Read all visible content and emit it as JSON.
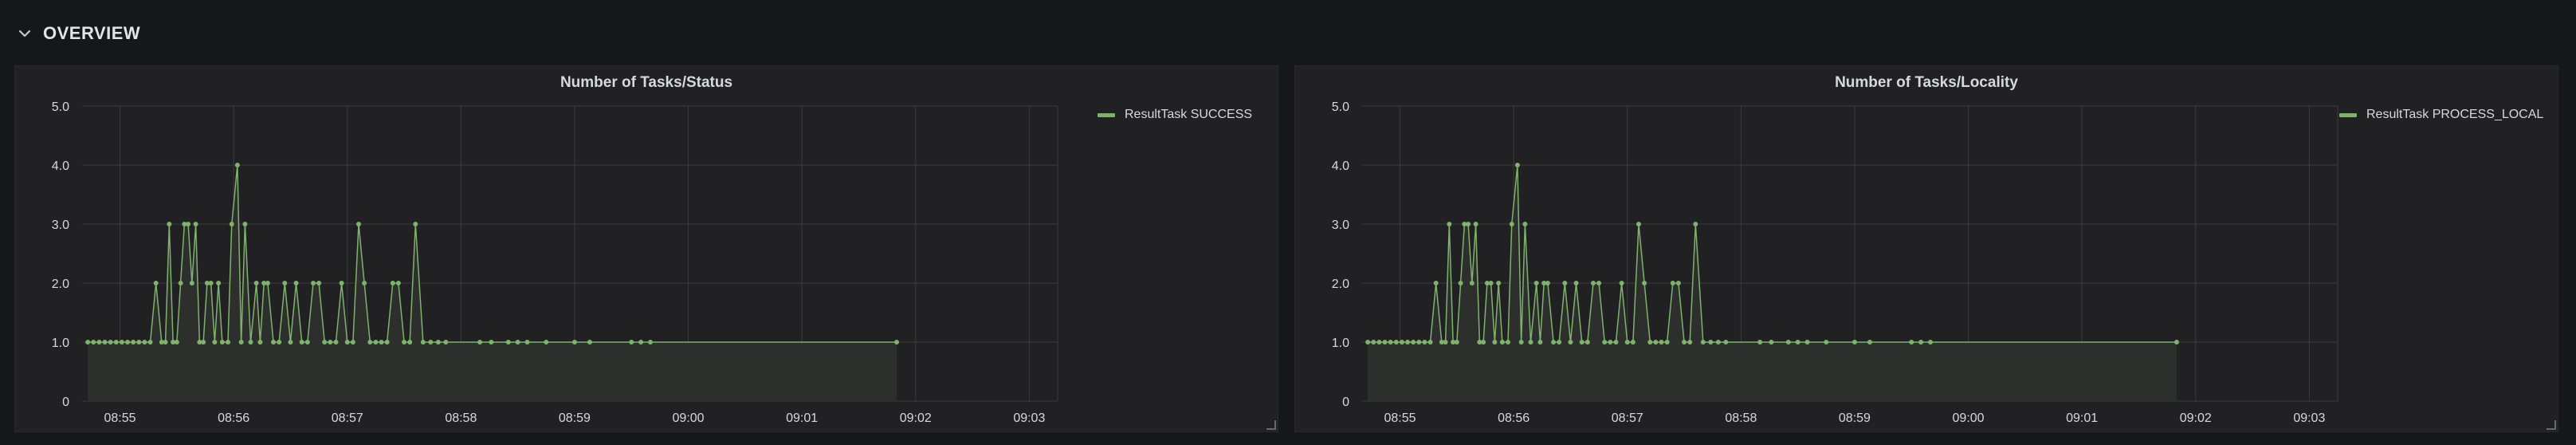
{
  "header": {
    "title": "OVERVIEW",
    "collapse_icon": "chevron-down-icon"
  },
  "colors": {
    "series": "#7eb26d",
    "fill": "#2d2f2c",
    "grid": "#3a3b3e"
  },
  "panels": [
    {
      "title": "Number of Tasks/Status",
      "legend": [
        "ResultTask SUCCESS"
      ]
    },
    {
      "title": "Number of Tasks/Locality",
      "legend": [
        "ResultTask PROCESS_LOCAL"
      ]
    }
  ],
  "chart_data": [
    {
      "type": "line",
      "title": "Number of Tasks/Status",
      "xlabel": "",
      "ylabel": "",
      "ylim": [
        0,
        5
      ],
      "yticks": [
        "0",
        "1.0",
        "2.0",
        "3.0",
        "4.0",
        "5.0"
      ],
      "xlim": [
        "08:54:40",
        "09:03:15"
      ],
      "xticks": [
        "08:55",
        "08:56",
        "08:57",
        "08:58",
        "08:59",
        "09:00",
        "09:01",
        "09:02",
        "09:03"
      ],
      "grid": true,
      "legend_position": "top-right",
      "series": [
        {
          "name": "ResultTask SUCCESS",
          "color": "#7eb26d",
          "x": [
            "08:54:43",
            "08:54:46",
            "08:54:49",
            "08:54:52",
            "08:54:55",
            "08:54:58",
            "08:55:01",
            "08:55:04",
            "08:55:07",
            "08:55:10",
            "08:55:13",
            "08:55:16",
            "08:55:19",
            "08:55:22",
            "08:55:24",
            "08:55:26",
            "08:55:28",
            "08:55:30",
            "08:55:32",
            "08:55:34",
            "08:55:36",
            "08:55:38",
            "08:55:40",
            "08:55:42",
            "08:55:44",
            "08:55:46",
            "08:55:48",
            "08:55:50",
            "08:55:52",
            "08:55:54",
            "08:55:57",
            "08:55:59",
            "08:56:02",
            "08:56:04",
            "08:56:06",
            "08:56:09",
            "08:56:12",
            "08:56:14",
            "08:56:16",
            "08:56:18",
            "08:56:21",
            "08:56:24",
            "08:56:27",
            "08:56:30",
            "08:56:33",
            "08:56:36",
            "08:56:39",
            "08:56:42",
            "08:56:45",
            "08:56:48",
            "08:56:51",
            "08:56:54",
            "08:56:57",
            "08:57:00",
            "08:57:03",
            "08:57:06",
            "08:57:09",
            "08:57:12",
            "08:57:15",
            "08:57:18",
            "08:57:21",
            "08:57:24",
            "08:57:27",
            "08:57:30",
            "08:57:33",
            "08:57:36",
            "08:57:40",
            "08:57:44",
            "08:57:48",
            "08:57:52",
            "08:58:10",
            "08:58:16",
            "08:58:25",
            "08:58:30",
            "08:58:35",
            "08:58:45",
            "08:59:00",
            "08:59:08",
            "08:59:30",
            "08:59:35",
            "08:59:40",
            "09:01:50"
          ],
          "y": [
            1,
            1,
            1,
            1,
            1,
            1,
            1,
            1,
            1,
            1,
            1,
            1,
            2,
            1,
            1,
            3,
            1,
            1,
            2,
            3,
            3,
            2,
            3,
            1,
            1,
            2,
            2,
            1,
            2,
            1,
            1,
            3,
            4,
            1,
            3,
            1,
            2,
            1,
            2,
            2,
            1,
            1,
            2,
            1,
            2,
            1,
            1,
            2,
            2,
            1,
            1,
            1,
            2,
            1,
            1,
            3,
            2,
            1,
            1,
            1,
            1,
            2,
            2,
            1,
            1,
            3,
            1,
            1,
            1,
            1,
            1,
            1,
            1,
            1,
            1,
            1,
            1,
            1,
            1,
            1,
            1,
            1
          ]
        }
      ]
    },
    {
      "type": "line",
      "title": "Number of Tasks/Locality",
      "xlabel": "",
      "ylabel": "",
      "ylim": [
        0,
        5
      ],
      "yticks": [
        "0",
        "1.0",
        "2.0",
        "3.0",
        "4.0",
        "5.0"
      ],
      "xlim": [
        "08:54:40",
        "09:03:15"
      ],
      "xticks": [
        "08:55",
        "08:56",
        "08:57",
        "08:58",
        "08:59",
        "09:00",
        "09:01",
        "09:02",
        "09:03"
      ],
      "grid": true,
      "legend_position": "top-right",
      "series": [
        {
          "name": "ResultTask PROCESS_LOCAL",
          "color": "#7eb26d",
          "x": [
            "08:54:43",
            "08:54:46",
            "08:54:49",
            "08:54:52",
            "08:54:55",
            "08:54:58",
            "08:55:01",
            "08:55:04",
            "08:55:07",
            "08:55:10",
            "08:55:13",
            "08:55:16",
            "08:55:19",
            "08:55:22",
            "08:55:24",
            "08:55:26",
            "08:55:28",
            "08:55:30",
            "08:55:32",
            "08:55:34",
            "08:55:36",
            "08:55:38",
            "08:55:40",
            "08:55:42",
            "08:55:44",
            "08:55:46",
            "08:55:48",
            "08:55:50",
            "08:55:52",
            "08:55:54",
            "08:55:57",
            "08:55:59",
            "08:56:02",
            "08:56:04",
            "08:56:06",
            "08:56:09",
            "08:56:12",
            "08:56:14",
            "08:56:16",
            "08:56:18",
            "08:56:21",
            "08:56:24",
            "08:56:27",
            "08:56:30",
            "08:56:33",
            "08:56:36",
            "08:56:39",
            "08:56:42",
            "08:56:45",
            "08:56:48",
            "08:56:51",
            "08:56:54",
            "08:56:57",
            "08:57:00",
            "08:57:03",
            "08:57:06",
            "08:57:09",
            "08:57:12",
            "08:57:15",
            "08:57:18",
            "08:57:21",
            "08:57:24",
            "08:57:27",
            "08:57:30",
            "08:57:33",
            "08:57:36",
            "08:57:40",
            "08:57:44",
            "08:57:48",
            "08:57:52",
            "08:58:10",
            "08:58:16",
            "08:58:25",
            "08:58:30",
            "08:58:35",
            "08:58:45",
            "08:59:00",
            "08:59:08",
            "08:59:30",
            "08:59:35",
            "08:59:40",
            "09:01:50"
          ],
          "y": [
            1,
            1,
            1,
            1,
            1,
            1,
            1,
            1,
            1,
            1,
            1,
            1,
            2,
            1,
            1,
            3,
            1,
            1,
            2,
            3,
            3,
            2,
            3,
            1,
            1,
            2,
            2,
            1,
            2,
            1,
            1,
            3,
            4,
            1,
            3,
            1,
            2,
            1,
            2,
            2,
            1,
            1,
            2,
            1,
            2,
            1,
            1,
            2,
            2,
            1,
            1,
            1,
            2,
            1,
            1,
            3,
            2,
            1,
            1,
            1,
            1,
            2,
            2,
            1,
            1,
            3,
            1,
            1,
            1,
            1,
            1,
            1,
            1,
            1,
            1,
            1,
            1,
            1,
            1,
            1,
            1,
            1
          ]
        }
      ]
    }
  ]
}
